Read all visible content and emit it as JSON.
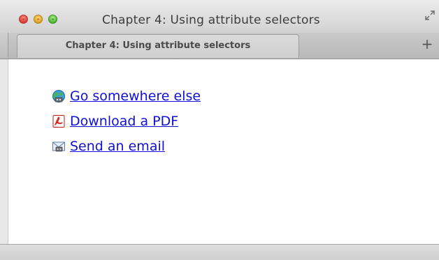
{
  "window": {
    "title": "Chapter 4: Using attribute selectors"
  },
  "tabs": [
    {
      "label": "Chapter 4: Using attribute selectors",
      "active": true
    }
  ],
  "toolbar": {
    "new_tab_label": "+"
  },
  "links": [
    {
      "label": "Go somewhere else",
      "icon": "globe-icon"
    },
    {
      "label": "Download a PDF",
      "icon": "pdf-icon"
    },
    {
      "label": "Send an email",
      "icon": "email-icon"
    }
  ],
  "colors": {
    "link": "#1010d8",
    "titlebar_top": "#ebebeb",
    "titlebar_bottom": "#d2d2d2",
    "close": "#e0443e",
    "minimize": "#e8a92a",
    "maximize": "#5cc13f"
  }
}
